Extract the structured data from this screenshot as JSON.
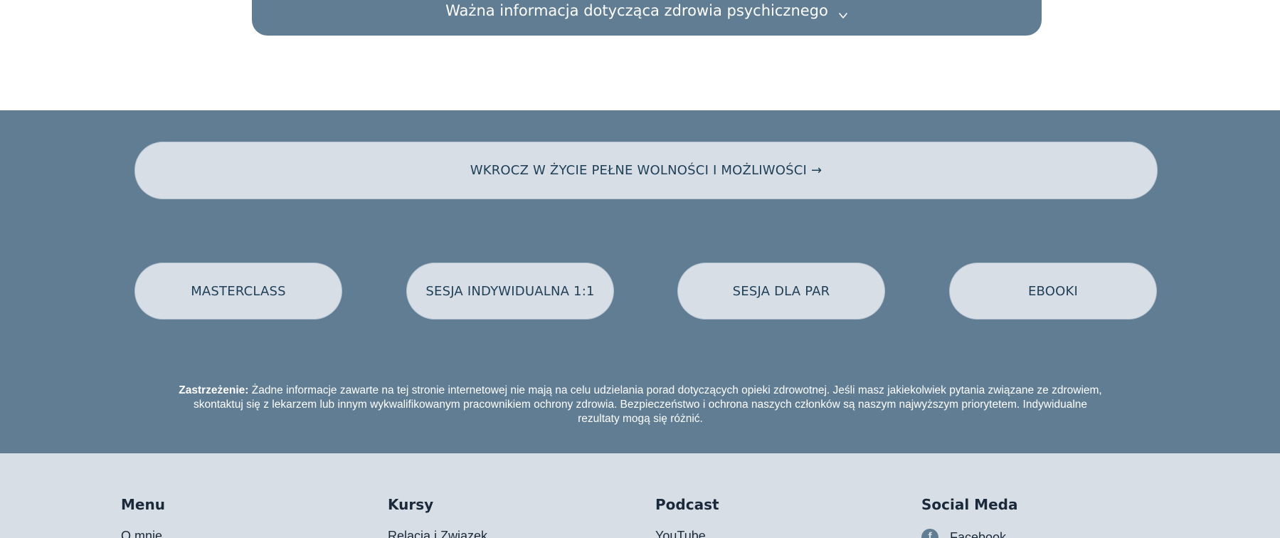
{
  "info_bar": {
    "label": "Ważna informacja dotycząca zdrowia psychicznego"
  },
  "cta": {
    "main_label": "WKROCZ W ŻYCIE PEŁNE WOLNOŚCI I MOŻLIWOŚCI →",
    "buttons": [
      {
        "label": "MASTERCLASS"
      },
      {
        "label": "SESJA INDYWIDUALNA 1:1"
      },
      {
        "label": "SESJA DLA PAR"
      },
      {
        "label": "EBOOKI"
      }
    ]
  },
  "disclaimer": {
    "title": "Zastrzeżenie:",
    "text": " Żadne informacje zawarte na tej stronie internetowej nie mają na celu udzielania porad dotyczących opieki zdrowotnej. Jeśli masz jakiekolwiek pytania związane ze zdrowiem, skontaktuj się z lekarzem lub innym wykwalifikowanym pracownikiem ochrony zdrowia. Bezpieczeństwo i ochrona naszych członków są naszym najwyższym priorytetem. Indywidualne rezultaty mogą się różnić."
  },
  "footer": {
    "columns": [
      {
        "heading": "Menu",
        "first_item": "O mnie"
      },
      {
        "heading": "Kursy",
        "first_item": "Relacja i Związek"
      },
      {
        "heading": "Podcast",
        "first_item": "YouTube"
      },
      {
        "heading": "Social Meda",
        "first_item": "Facebook",
        "first_item_icon": "facebook-icon"
      }
    ]
  },
  "colors": {
    "primary_blue": "#607d93",
    "light_gray_blue": "#d7dee6",
    "dark_text": "#1a2a3a",
    "pill_text": "#1f3f57"
  }
}
